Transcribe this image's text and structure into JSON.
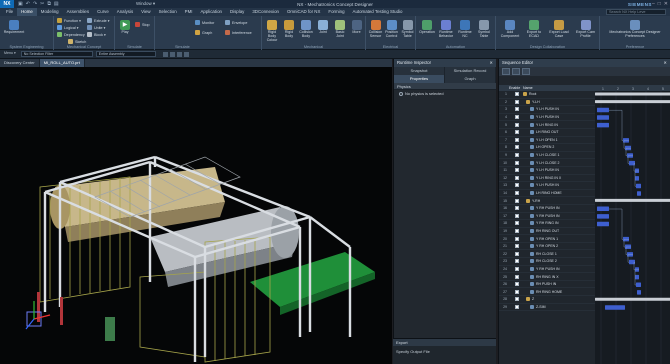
{
  "titlebar": {
    "logo": "NX",
    "window_menu": "Window ▾",
    "title": "NX - Mechatronics Concept Designer",
    "brand": "SIEMENS"
  },
  "menubar": {
    "tabs": [
      "File",
      "Home",
      "Modeling",
      "Assemblies",
      "Curve",
      "Analysis",
      "View",
      "Selection",
      "PMI",
      "Application",
      "Display",
      "3DConnexion",
      "OmniCAD for NX",
      "Forming",
      "Automated Testing Studio"
    ],
    "active": "Home",
    "search_placeholder": "Search NX Help Leve"
  },
  "ribbon": {
    "groups": [
      {
        "label": "System Engineering",
        "buttons": [
          "Requirement"
        ]
      },
      {
        "label": "Mechanical Concept",
        "small": [
          "Function ▾",
          "Logical ▾",
          "Dependency",
          "Extrude ▾",
          "Sketch",
          "Unite ▾",
          "Block ▾"
        ]
      },
      {
        "label": "Simulate",
        "buttons": [
          "Play"
        ],
        "small": [
          "Stop"
        ]
      },
      {
        "label": "",
        "small": [
          "Monitor",
          "Graph",
          "Envelope",
          "Interference"
        ]
      },
      {
        "label": "Mechanical",
        "buttons": [
          "Rigid Body Colour",
          "Rigid Body",
          "Collision Body",
          "Joint",
          "Basic Joint",
          "More"
        ]
      },
      {
        "label": "Electrical",
        "buttons": [
          "Collision Sensor",
          "Position Control",
          "Symbol Table"
        ]
      },
      {
        "label": "Automation",
        "buttons": [
          "Operation",
          "Runtime Behavior",
          "Runtime NC",
          "Symbol Table"
        ]
      },
      {
        "label": "Design Collaboration",
        "buttons": [
          "Add Component",
          "Export to ECAD",
          "Export Load Case",
          "Export Cam Profile"
        ]
      },
      {
        "label": "Preference",
        "buttons": [
          "Mechatronics Concept Designer Preferences"
        ]
      }
    ]
  },
  "subbar": {
    "menu": "Menu ▾",
    "filter": "No Selection Filter",
    "scope": "Entire Assembly"
  },
  "viewtabs": {
    "discovery": "Discovery Center",
    "model": "MI_ROLL_AUTO.prt"
  },
  "runtime": {
    "title": "Runtime Inspector",
    "tabs": [
      "Snapshot",
      "Simulation Record"
    ],
    "subtabs": [
      "Properties",
      "Graph"
    ],
    "physics_header": "Physics",
    "physics_item": "No physics is selected",
    "footer_header": "Export",
    "footer_item": "Specify Output File"
  },
  "sequence": {
    "title": "Sequence Editor",
    "columns": [
      "",
      "Enable",
      "Name"
    ],
    "rows": [
      {
        "n": "1",
        "name": "Root"
      },
      {
        "n": "2",
        "name": "Y-LH"
      },
      {
        "n": "3",
        "name": "Y LH PUSH IN"
      },
      {
        "n": "4",
        "name": "Y LH PUSH IN"
      },
      {
        "n": "5",
        "name": "Y LH RING IN"
      },
      {
        "n": "6",
        "name": "LH RING OUT"
      },
      {
        "n": "7",
        "name": "Y LH OPEN 1"
      },
      {
        "n": "8",
        "name": "LH OPEN 2"
      },
      {
        "n": "9",
        "name": "Y LH CLOSE 1"
      },
      {
        "n": "10",
        "name": "Y LH CLOSE 2"
      },
      {
        "n": "11",
        "name": "Y LH PUSH IN"
      },
      {
        "n": "12",
        "name": "Y LH RING IN X"
      },
      {
        "n": "13",
        "name": "Y LH PUSH IN"
      },
      {
        "n": "14",
        "name": "LH RING HOME"
      },
      {
        "n": "15",
        "name": "Y-RH"
      },
      {
        "n": "16",
        "name": "Y RH PUSH IN"
      },
      {
        "n": "17",
        "name": "Y RH PUSH IN"
      },
      {
        "n": "18",
        "name": "Y RH RING IN"
      },
      {
        "n": "19",
        "name": "RH RING OUT"
      },
      {
        "n": "20",
        "name": "Y RH OPEN 1"
      },
      {
        "n": "21",
        "name": "Y RH OPEN 2"
      },
      {
        "n": "22",
        "name": "RH CLOSE 1"
      },
      {
        "n": "23",
        "name": "RH CLOSE 2"
      },
      {
        "n": "24",
        "name": "Y RH PUSH IN"
      },
      {
        "n": "25",
        "name": "RH RING IN X"
      },
      {
        "n": "26",
        "name": "RH PUSH IN"
      },
      {
        "n": "27",
        "name": "RH RING HOME"
      },
      {
        "n": "28",
        "name": "Z"
      },
      {
        "n": "29",
        "name": "Z-SIM"
      }
    ],
    "ruler": [
      "1",
      "2",
      "3",
      "4",
      "5"
    ]
  },
  "colors": {
    "accent": "#1a7fd0",
    "bar": "#3e5fcf",
    "frame": "#d9dde2",
    "fence": "#a6a44a",
    "green": "#1f8f39"
  }
}
